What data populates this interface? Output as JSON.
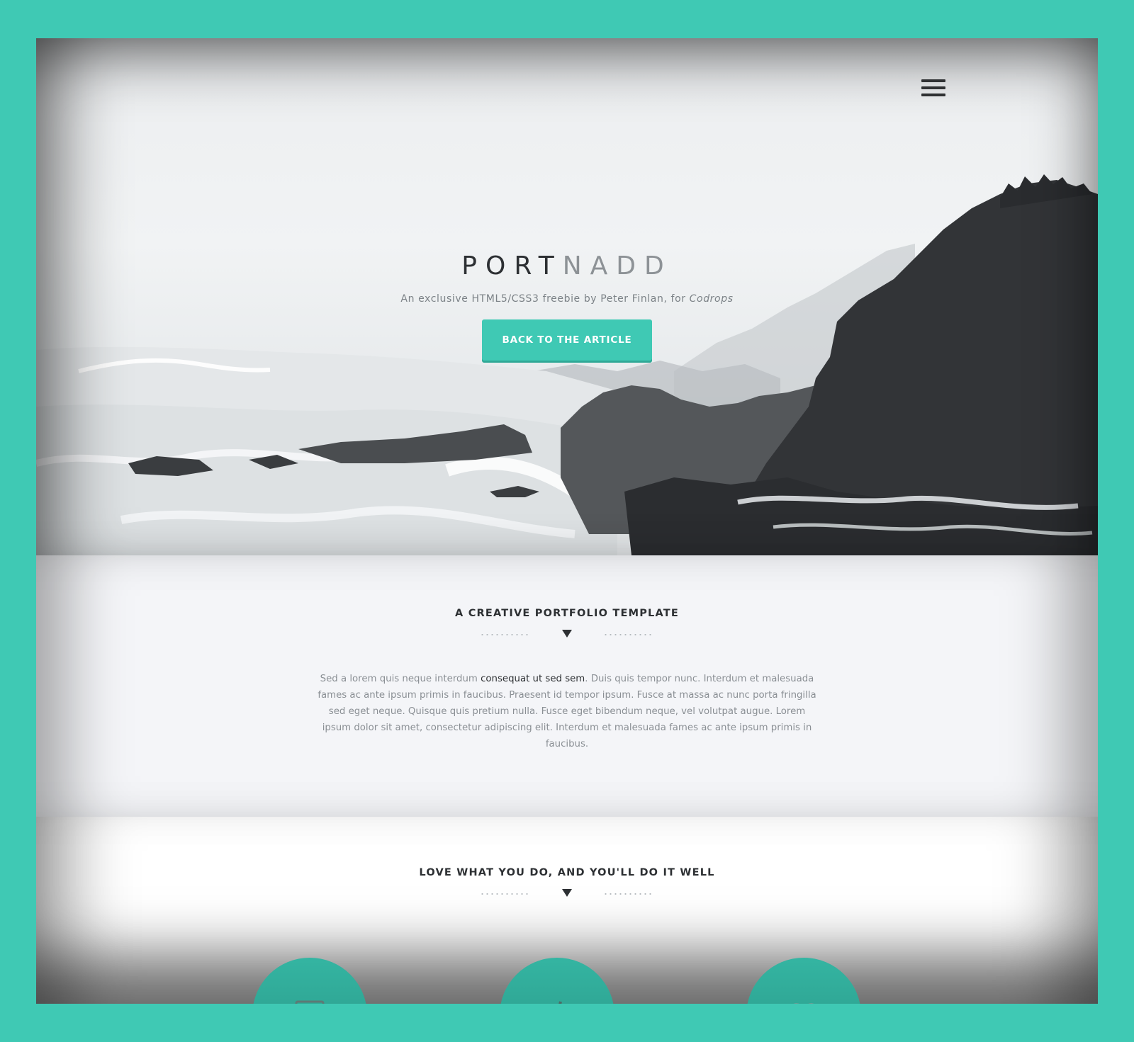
{
  "page": {
    "background_color": "#3fc9b4",
    "accent_color": "#3fc9b4"
  },
  "header": {
    "menu_icon": "hamburger-menu-icon",
    "brand_part1": "PORT",
    "brand_part2": "NADD",
    "tagline": "An exclusive HTML5/CSS3 freebie by Peter Finlan, for ",
    "tagline_link": "Codrops",
    "cta_label": "BACK TO THE ARTICLE"
  },
  "section_intro": {
    "title": "A CREATIVE PORTFOLIO TEMPLATE",
    "divider_icon": "triangle-down-icon",
    "text_before": "Sed a lorem quis neque interdum ",
    "text_highlight": "consequat ut sed sem",
    "text_after": ". Duis quis tempor nunc. Interdum et malesuada fames ac ante ipsum primis in faucibus. Praesent id tempor ipsum. Fusce at massa ac nunc porta fringilla sed eget neque. Quisque quis pretium nulla. Fusce eget bibendum neque, vel volutpat augue. Lorem ipsum dolor sit amet, consectetur adipiscing elit. Interdum et malesuada fames ac ante ipsum primis in faucibus."
  },
  "section_services": {
    "title": "LOVE WHAT YOU DO, AND YOU'LL DO IT WELL",
    "divider_icon": "triangle-down-icon",
    "features": [
      {
        "icon": "monitor-icon"
      },
      {
        "icon": "pencil-icon"
      },
      {
        "icon": "heart-icon"
      }
    ]
  }
}
